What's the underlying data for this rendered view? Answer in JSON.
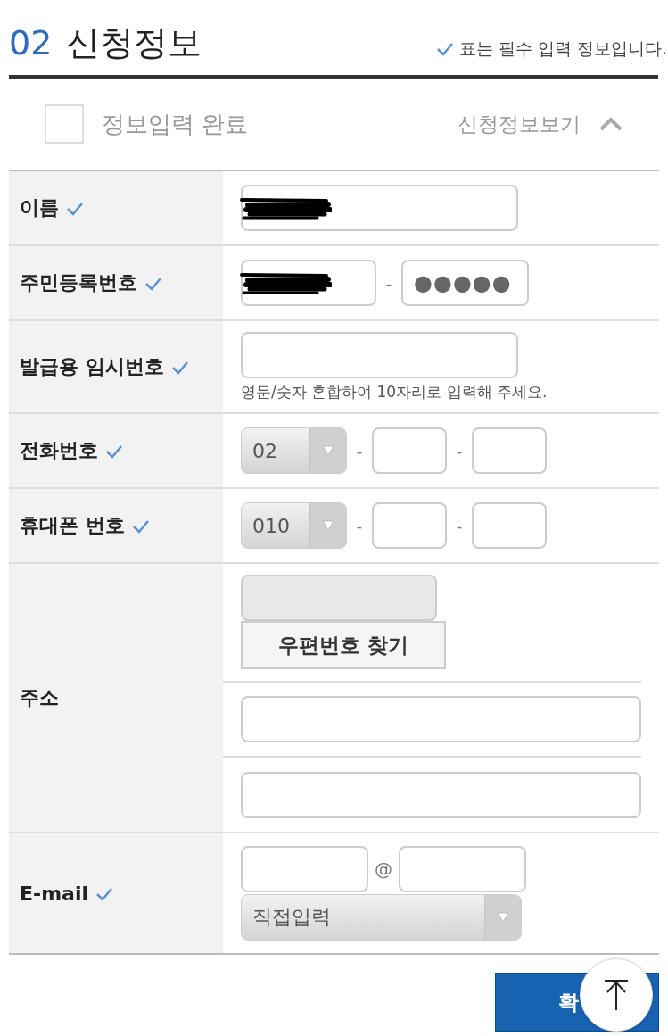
{
  "header": {
    "number": "02",
    "title": "신청정보",
    "required_note": "표는 필수 입력 정보입니다."
  },
  "completion": {
    "label": "정보입력 완료",
    "checked": false
  },
  "toggle": {
    "label": "신청정보보기",
    "expanded": true
  },
  "rows": [
    {
      "kind": "text",
      "label": "이름",
      "required": true,
      "redacted": true
    },
    {
      "kind": "id",
      "label": "주민등록번호",
      "required": true,
      "redacted": true,
      "separator": "-",
      "masked_value": "●●●●●"
    },
    {
      "kind": "hint",
      "label": "발급용 임시번호",
      "required": true,
      "hint": "영문/숫자 혼합하여 10자리로 입력해 주세요."
    },
    {
      "kind": "phone",
      "label": "전화번호",
      "required": true,
      "prefix": "02",
      "separators": [
        "-",
        "-"
      ]
    },
    {
      "kind": "phone",
      "label": "휴대폰 번호",
      "required": true,
      "prefix": "010",
      "separators": [
        "-",
        "-"
      ]
    },
    {
      "kind": "address",
      "label": "주소",
      "required": false,
      "button": "우편번호 찾기"
    },
    {
      "kind": "email",
      "label": "E-mail",
      "required": true,
      "at": "@",
      "domain_select": "직접입력"
    }
  ],
  "submit": {
    "label": "확"
  }
}
